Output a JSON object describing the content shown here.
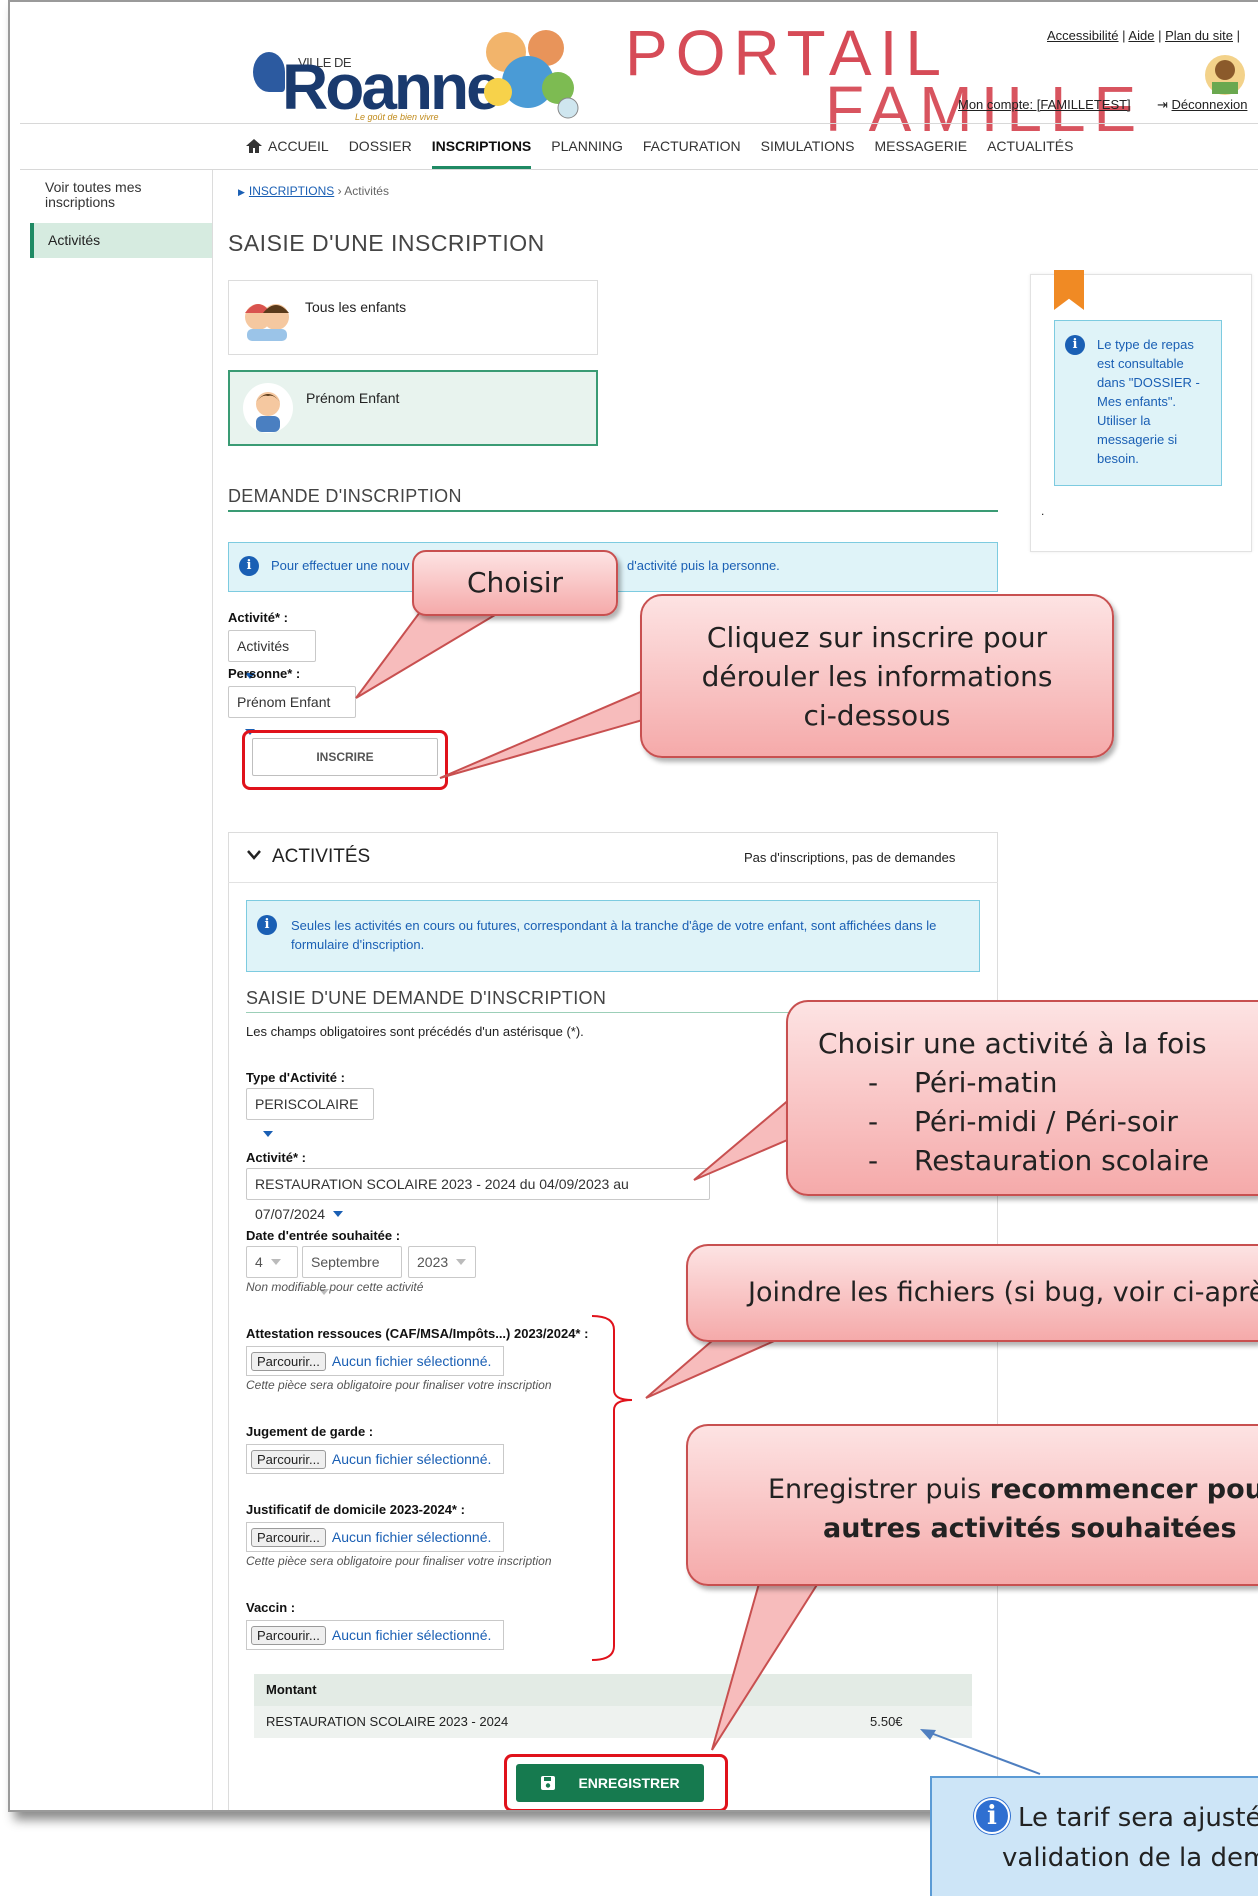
{
  "header": {
    "logo_ville": "VILLE DE",
    "logo_name": "Roanne",
    "logo_tagline": "Le goût de bien vivre",
    "portail_line1": "PORTAIL",
    "portail_line2": "FAMILLE",
    "top_links": [
      "Accessibilité",
      "Aide",
      "Plan du site"
    ],
    "account_label": "Mon compte: [FAMILLETEST]",
    "logout_label": "Déconnexion"
  },
  "nav": {
    "items": [
      "ACCUEIL",
      "DOSSIER",
      "INSCRIPTIONS",
      "PLANNING",
      "FACTURATION",
      "SIMULATIONS",
      "MESSAGERIE",
      "ACTUALITÉS"
    ],
    "active": "INSCRIPTIONS"
  },
  "sidebar": {
    "link": "Voir toutes mes inscriptions",
    "active_item": "Activités"
  },
  "breadcrumb": {
    "root": "INSCRIPTIONS",
    "current": "Activités"
  },
  "page_title": "SAISIE D'UNE INSCRIPTION",
  "children": {
    "all": "Tous les enfants",
    "selected": "Prénom Enfant"
  },
  "side_note": {
    "text": "Le type de repas est consultable dans \"DOSSIER - Mes enfants\". Utiliser la messagerie si besoin.",
    "dot": "."
  },
  "demande": {
    "title": "DEMANDE D'INSCRIPTION",
    "info_left": "Pour effectuer une nouv",
    "info_right": "d'activité puis la personne.",
    "activite_label": "Activité* :",
    "activite_value": "Activités",
    "personne_label": "Personne* :",
    "personne_value": "Prénom Enfant",
    "inscrire_button": "INSCRIRE"
  },
  "activites": {
    "header": "ACTIVITÉS",
    "status": "Pas d'inscriptions, pas de demandes",
    "info": "Seules les activités en cours ou futures, correspondant à la tranche d'âge de votre enfant, sont affichées dans le formulaire d'inscription.",
    "form_title": "SAISIE D'UNE DEMANDE D'INSCRIPTION",
    "mandatory_note": "Les champs obligatoires sont précédés d'un astérisque (*).",
    "type_label": "Type d'Activité :",
    "type_value": "PERISCOLAIRE",
    "activite_label": "Activité* :",
    "activite_value": "RESTAURATION SCOLAIRE 2023 - 2024 du 04/09/2023 au 07/07/2024",
    "date_label": "Date d'entrée souhaitée :",
    "date_day": "4",
    "date_month": "Septembre",
    "date_year": "2023",
    "date_help": "Non modifiable pour cette activité",
    "files": [
      {
        "label": "Attestation ressouces (CAF/MSA/Impôts...) 2023/2024* :",
        "button": "Parcourir...",
        "status": "Aucun fichier sélectionné.",
        "help": "Cette pièce sera obligatoire pour finaliser votre inscription"
      },
      {
        "label": "Jugement de garde :",
        "button": "Parcourir...",
        "status": "Aucun fichier sélectionné.",
        "help": ""
      },
      {
        "label": "Justificatif de domicile 2023-2024* :",
        "button": "Parcourir...",
        "status": "Aucun fichier sélectionné.",
        "help": "Cette pièce sera obligatoire pour finaliser votre inscription"
      },
      {
        "label": "Vaccin :",
        "button": "Parcourir...",
        "status": "Aucun fichier sélectionné.",
        "help": ""
      }
    ],
    "montant_header": "Montant",
    "montant_item": "RESTAURATION SCOLAIRE 2023 - 2024",
    "montant_value": "5.50€",
    "save_button": "ENREGISTRER"
  },
  "callouts": {
    "choisir": "Choisir",
    "inscrire": "Cliquez sur inscrire pour dérouler les informations ci-dessous",
    "activite_title": "Choisir une activité à la fois",
    "activite_items": [
      "Péri-matin",
      "Péri-midi / Péri-soir",
      "Restauration scolaire"
    ],
    "fichiers": "Joindre les fichiers (si bug, voir ci-après)",
    "enregistrer_normal": "Enregistrer puis ",
    "enregistrer_bold1": "recommencer pour les",
    "enregistrer_bold2": "autres activités souhaitées",
    "tarif_line1": "Le tarif sera ajusté",
    "tarif_line2": "validation de la dem"
  },
  "colors": {
    "accent_green": "#1f8a64",
    "info_blue": "#1a5fb4",
    "highlight_red": "#e0121b",
    "portail_pink": "#d64b57"
  }
}
